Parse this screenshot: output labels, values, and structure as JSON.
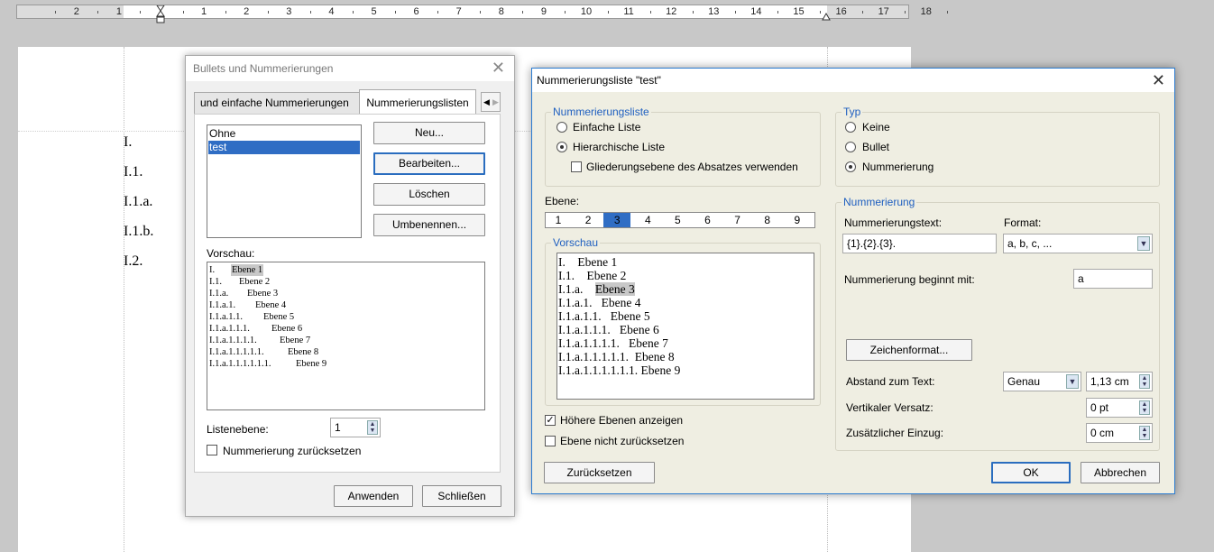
{
  "ruler": {
    "labels": [
      "2",
      "1",
      "1",
      "2",
      "3",
      "4",
      "5",
      "6",
      "7",
      "8",
      "9",
      "10",
      "11",
      "12",
      "13",
      "14",
      "15",
      "16",
      "17",
      "18"
    ]
  },
  "document": {
    "lines": [
      "I.",
      "I.1.",
      "I.1.a.",
      "I.1.b.",
      "I.2."
    ]
  },
  "bullets_dialog": {
    "title": "Bullets und Nummerierungen",
    "tabs": [
      "und einfache Nummerierungen",
      "Nummerierungslisten"
    ],
    "list_items": [
      "Ohne",
      "test"
    ],
    "selected_item": "test",
    "buttons": {
      "new": "Neu...",
      "edit": "Bearbeiten...",
      "delete": "Löschen",
      "rename": "Umbenennen..."
    },
    "preview_label": "Vorschau:",
    "preview_lines": [
      {
        "num": "I.",
        "text": "Ebene 1"
      },
      {
        "num": "I.1.",
        "text": "Ebene 2"
      },
      {
        "num": "I.1.a.",
        "text": "Ebene 3"
      },
      {
        "num": "I.1.a.1.",
        "text": "Ebene 4"
      },
      {
        "num": "I.1.a.1.1.",
        "text": "Ebene 5"
      },
      {
        "num": "I.1.a.1.1.1.",
        "text": "Ebene 6"
      },
      {
        "num": "I.1.a.1.1.1.1.",
        "text": "Ebene 7"
      },
      {
        "num": "I.1.a.1.1.1.1.1.",
        "text": "Ebene 8"
      },
      {
        "num": "I.1.a.1.1.1.1.1.1.",
        "text": "Ebene 9"
      }
    ],
    "level_label": "Listenebene:",
    "level_value": "1",
    "reset_label": "Nummerierung zurücksetzen",
    "apply": "Anwenden",
    "close": "Schließen"
  },
  "numbering_dialog": {
    "title": "Nummerierungsliste \"test\"",
    "list_group": "Nummerierungsliste",
    "simple_list": "Einfache Liste",
    "hier_list": "Hierarchische Liste",
    "outline_level": "Gliederungsebene des Absatzes verwenden",
    "type_group": "Typ",
    "type_none": "Keine",
    "type_bullet": "Bullet",
    "type_numbering": "Nummerierung",
    "level_label": "Ebene:",
    "levels": [
      "1",
      "2",
      "3",
      "4",
      "5",
      "6",
      "7",
      "8",
      "9"
    ],
    "selected_level": "3",
    "preview_group": "Vorschau",
    "preview_lines": [
      "I.    Ebene 1",
      "I.1.    Ebene 2",
      "I.1.a.    Ebene 3",
      "I.1.a.1.   Ebene 4",
      "I.1.a.1.1.   Ebene 5",
      "I.1.a.1.1.1.   Ebene 6",
      "I.1.a.1.1.1.1.   Ebene 7",
      "I.1.a.1.1.1.1.1.  Ebene 8",
      "I.1.a.1.1.1.1.1.1. Ebene 9"
    ],
    "higher_levels": "Höhere Ebenen anzeigen",
    "no_reset": "Ebene nicht zurücksetzen",
    "reset_button": "Zurücksetzen",
    "numbering_group": "Nummerierung",
    "num_text_label": "Nummerierungstext:",
    "num_text_value": "{1}.{2}.{3}.",
    "format_label": "Format:",
    "format_value": "a, b, c, ...",
    "start_label": "Nummerierung beginnt mit:",
    "start_value": "a",
    "char_format": "Zeichenformat...",
    "spacing_label": "Abstand zum Text:",
    "spacing_mode": "Genau",
    "spacing_value": "1,13 cm",
    "vertical_label": "Vertikaler Versatz:",
    "vertical_value": "0 pt",
    "indent_label": "Zusätzlicher Einzug:",
    "indent_value": "0 cm",
    "ok": "OK",
    "cancel": "Abbrechen"
  }
}
